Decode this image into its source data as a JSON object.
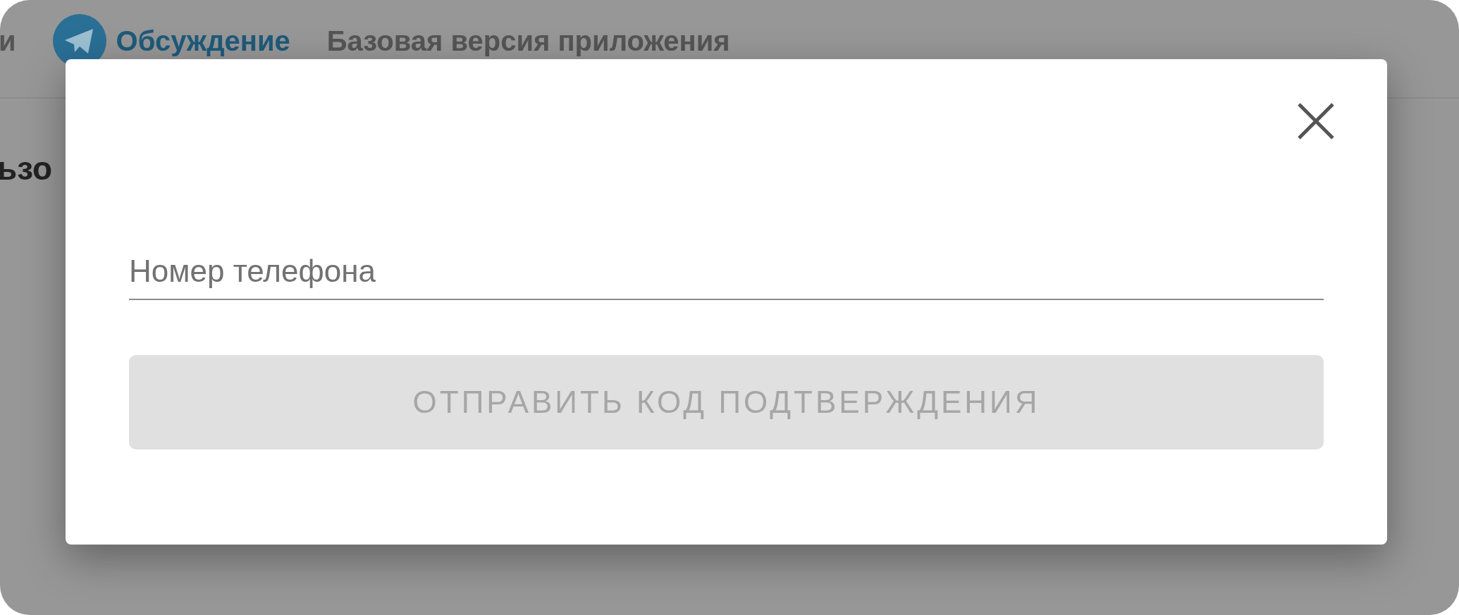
{
  "nav": {
    "items": [
      {
        "kind": "text",
        "label": "и"
      },
      {
        "kind": "link",
        "label": "Обсуждение"
      },
      {
        "kind": "text",
        "label": "Базовая версия приложения"
      }
    ]
  },
  "page_heading": "ьзо",
  "dialog": {
    "phone_field": {
      "placeholder": "Номер телефона"
    },
    "submit_button": {
      "label": "ОТПРАВИТЬ КОД ПОДТВЕРЖДЕНИЯ",
      "disabled": true
    }
  }
}
